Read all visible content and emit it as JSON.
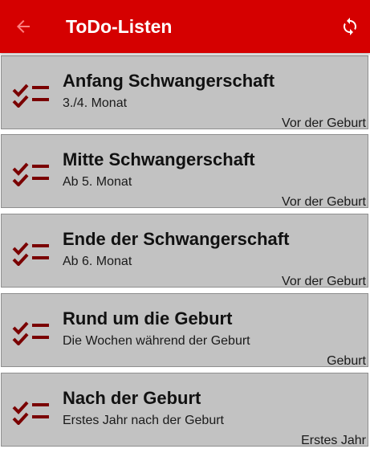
{
  "appbar": {
    "title": "ToDo-Listen",
    "back_icon": "arrow-back-icon",
    "sync_icon": "sync-icon",
    "background_color": "#d50000"
  },
  "lists": [
    {
      "title": "Anfang Schwangerschaft",
      "subtitle": "3./4. Monat",
      "category": "Vor der Geburt",
      "icon": "checklist-icon"
    },
    {
      "title": "Mitte Schwangerschaft",
      "subtitle": "Ab 5. Monat",
      "category": "Vor der Geburt",
      "icon": "checklist-icon"
    },
    {
      "title": "Ende der Schwangerschaft",
      "subtitle": "Ab 6. Monat",
      "category": "Vor der Geburt",
      "icon": "checklist-icon"
    },
    {
      "title": "Rund um die Geburt",
      "subtitle": "Die Wochen während der Geburt",
      "category": "Geburt",
      "icon": "checklist-icon"
    },
    {
      "title": "Nach der Geburt",
      "subtitle": "Erstes Jahr nach der Geburt",
      "category": "Erstes Jahr",
      "icon": "checklist-icon"
    }
  ],
  "colors": {
    "card_background": "#c2c2c2",
    "icon_color": "#7a0000"
  }
}
